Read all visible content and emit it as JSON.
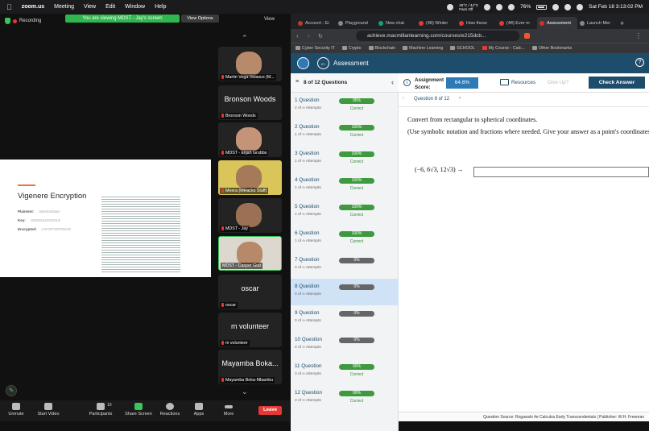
{
  "menubar": {
    "items": [
      "zoom.us",
      "Meeting",
      "View",
      "Edit",
      "Window",
      "Help"
    ],
    "weather": "45°C / 44°C",
    "weather2": "Fans Off",
    "battery": "76%",
    "datetime": "Sat Feb 18  3:13:02 PM"
  },
  "zoom": {
    "recording": "Recording",
    "viewing": "You are viewing MDST - Jay's screen",
    "view_options": "View Options",
    "view": "View",
    "slide": {
      "title": "Vigenere Encryption",
      "rows": [
        {
          "k": "Plaintext:",
          "v": "attackatdawn"
        },
        {
          "k": "Key:",
          "v": "LEMONLEMONLE"
        },
        {
          "k": "Encrypted:",
          "v": "LXFOPVEFRNHR"
        }
      ]
    },
    "participants": [
      {
        "name": "Martin Vega-Velasco (M...",
        "video": true
      },
      {
        "name": "Bronson Woods",
        "big": "Bronson Woods"
      },
      {
        "name": "MDST - Elijah Grubbs",
        "video": true
      },
      {
        "name": "Meera (MHacks Staff)",
        "video": true
      },
      {
        "name": "MDST - Jay",
        "video": true
      },
      {
        "name": "MDST - Casper Guo",
        "video": true
      },
      {
        "name": "oscar",
        "big": "oscar"
      },
      {
        "name": "m volunteer",
        "big": "m volunteer"
      },
      {
        "name": "Mayamba Boka-Mbambu",
        "big": "Mayamba Boka..."
      }
    ],
    "toolbar": [
      {
        "label": "Unmute"
      },
      {
        "label": "Start Video"
      },
      {
        "label": "Participants",
        "count": "10"
      },
      {
        "label": "Share Screen"
      },
      {
        "label": "Reactions"
      },
      {
        "label": "Apps"
      },
      {
        "label": "More"
      }
    ],
    "leave": "Leave"
  },
  "browser": {
    "tabs": [
      "Account - Ei",
      "Playground",
      "New chat",
      "(48) Winter",
      "How these",
      "(48) Ever m",
      "Assessment",
      "Launch Mer"
    ],
    "url": "achieve.macmillanlearning.com/courses/e215dcb...",
    "bookmarks": [
      "Cyber Security IT",
      "Crypto",
      "Blockchain",
      "Machine Learning",
      "SCHOOL",
      "My Course - Calc...",
      "Other Bookmarks"
    ],
    "header": "Assessment",
    "qcount": "8 of 12 Questions",
    "score_label": "Assignment Score:",
    "score": "64.6%",
    "resources": "Resources",
    "give_up": "Give Up?",
    "check": "Check Answer",
    "qnav": "Question 8 of 12",
    "questions": [
      {
        "n": "1 Question",
        "att": "2 of ∞ Attempts",
        "pct": "95%",
        "status": "Correct",
        "color": "#3f9a3f"
      },
      {
        "n": "2 Question",
        "att": "1 of ∞ Attempts",
        "pct": "100%",
        "status": "Correct",
        "color": "#3f9a3f"
      },
      {
        "n": "3 Question",
        "att": "1 of ∞ Attempts",
        "pct": "100%",
        "status": "Correct",
        "color": "#3f9a3f"
      },
      {
        "n": "4 Question",
        "att": "1 of ∞ Attempts",
        "pct": "100%",
        "status": "Correct",
        "color": "#3f9a3f"
      },
      {
        "n": "5 Question",
        "att": "1 of ∞ Attempts",
        "pct": "100%",
        "status": "Correct",
        "color": "#3f9a3f"
      },
      {
        "n": "6 Question",
        "att": "1 of ∞ Attempts",
        "pct": "100%",
        "status": "Correct",
        "color": "#3f9a3f"
      },
      {
        "n": "7 Question",
        "att": "0 of ∞ Attempts",
        "pct": "0%",
        "status": "",
        "color": "#666"
      },
      {
        "n": "8 Question",
        "att": "0 of ∞ Attempts",
        "pct": "0%",
        "status": "",
        "color": "#666"
      },
      {
        "n": "9 Question",
        "att": "0 of ∞ Attempts",
        "pct": "0%",
        "status": "",
        "color": "#666"
      },
      {
        "n": "10 Question",
        "att": "0 of ∞ Attempts",
        "pct": "0%",
        "status": "",
        "color": "#666"
      },
      {
        "n": "11 Question",
        "att": "3 of ∞ Attempts",
        "pct": "90%",
        "status": "Correct",
        "color": "#3f9a3f"
      },
      {
        "n": "12 Question",
        "att": "3 of ∞ Attempts",
        "pct": "90%",
        "status": "Correct",
        "color": "#3f9a3f"
      }
    ],
    "prompt": "Convert from rectangular to spherical coordinates.",
    "instructions": "(Use symbolic notation and fractions where needed. Give your answer as a point's coordinates",
    "point": "(−6, 6√3, 12√3)  →",
    "footer": "Question Source: Rogawski 4e Calculus Early Transcendentals  |  Publisher: W.H. Freeman"
  }
}
